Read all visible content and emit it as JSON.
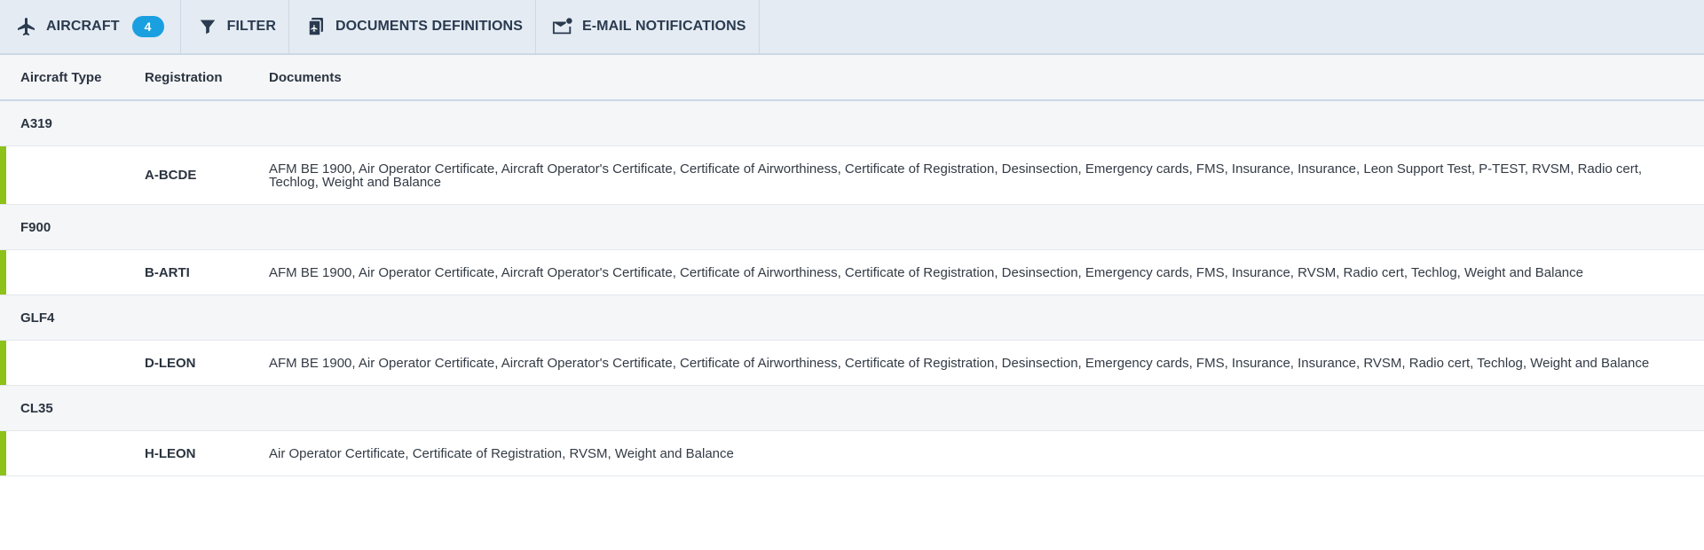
{
  "toolbar": {
    "aircraft_label": "AIRCRAFT",
    "aircraft_count": "4",
    "filter_label": "FILTER",
    "documents_definitions_label": "DOCUMENTS DEFINITIONS",
    "email_notifications_label": "E-MAIL NOTIFICATIONS",
    "icons": {
      "aircraft": "airplane-icon",
      "filter": "filter-icon",
      "documents": "documents-icon",
      "email": "email-notification-icon"
    }
  },
  "table": {
    "headers": {
      "aircraft_type": "Aircraft Type",
      "registration": "Registration",
      "documents": "Documents"
    },
    "groups": [
      {
        "type": "A319",
        "rows": [
          {
            "registration": "A-BCDE",
            "documents": "AFM BE 1900, Air Operator Certificate, Aircraft Operator's Certificate, Certificate of Airworthiness, Certificate of Registration, Desinsection, Emergency cards, FMS, Insurance, Insurance, Leon Support Test, P-TEST, RVSM, Radio cert, Techlog, Weight and Balance"
          }
        ]
      },
      {
        "type": "F900",
        "rows": [
          {
            "registration": "B-ARTI",
            "documents": "AFM BE 1900, Air Operator Certificate, Aircraft Operator's Certificate, Certificate of Airworthiness, Certificate of Registration, Desinsection, Emergency cards, FMS, Insurance, RVSM, Radio cert, Techlog, Weight and Balance"
          }
        ]
      },
      {
        "type": "GLF4",
        "rows": [
          {
            "registration": "D-LEON",
            "documents": "AFM BE 1900, Air Operator Certificate, Aircraft Operator's Certificate, Certificate of Airworthiness, Certificate of Registration, Desinsection, Emergency cards, FMS, Insurance, Insurance, RVSM, Radio cert, Techlog, Weight and Balance"
          }
        ]
      },
      {
        "type": "CL35",
        "rows": [
          {
            "registration": "H-LEON",
            "documents": "Air Operator Certificate, Certificate of Registration, RVSM, Weight and Balance"
          }
        ]
      }
    ]
  },
  "colors": {
    "accent": "#1aa0e0",
    "row_marker": "#8cc21a",
    "toolbar_bg": "#e4ebf3",
    "header_bg": "#f4f6f8"
  }
}
